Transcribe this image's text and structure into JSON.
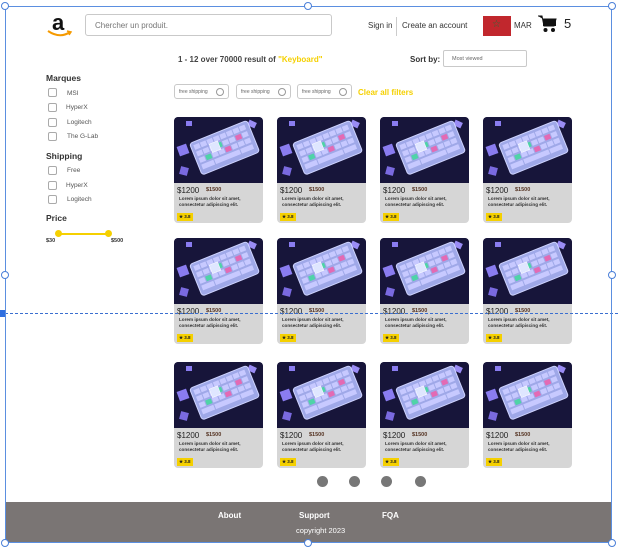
{
  "header": {
    "logo_letter": "a",
    "search_placeholder": "Chercher un produit.",
    "signin_label": "Sign in",
    "create_label": "Create an account",
    "country": "MAR",
    "cart_count": "5",
    "colors": {
      "flag_red": "#c1272d",
      "flag_green": "#1f6e3a"
    }
  },
  "results": {
    "text": "1 - 12 over 70000 result of",
    "keyword": "\"Keyboard\"",
    "sort_label": "Sort by:",
    "sort_value": "Most viewed"
  },
  "sidebar": {
    "brands_title": "Marques",
    "brands": [
      "MSI",
      "HyperX",
      "Logitech",
      "The G-Lab"
    ],
    "shipping_title": "Shipping",
    "shipping": [
      "Free",
      "HyperX",
      "Logitech"
    ],
    "price_title": "Price",
    "price_min": "$30",
    "price_max": "$500"
  },
  "filters": {
    "chips": [
      "free shipping",
      "free shipping",
      "free shipping"
    ],
    "clear_label": "Clear all filters",
    "accent": "#f5d000"
  },
  "products": [
    {
      "price": "$1200",
      "old_price": "$1500",
      "desc": "Lorem ipsum dolor sit amet, consectetur adipiscing elit.",
      "rating": "★ 3.8"
    },
    {
      "price": "$1200",
      "old_price": "$1500",
      "desc": "Lorem ipsum dolor sit amet, consectetur adipiscing elit.",
      "rating": "★ 3.8"
    },
    {
      "price": "$1200",
      "old_price": "$1500",
      "desc": "Lorem ipsum dolor sit amet, consectetur adipiscing elit.",
      "rating": "★ 3.8"
    },
    {
      "price": "$1200",
      "old_price": "$1500",
      "desc": "Lorem ipsum dolor sit amet, consectetur adipiscing elit.",
      "rating": "★ 3.8"
    },
    {
      "price": "$1200",
      "old_price": "$1500",
      "desc": "Lorem ipsum dolor sit amet, consectetur adipiscing elit.",
      "rating": "★ 3.8"
    },
    {
      "price": "$1200",
      "old_price": "$1500",
      "desc": "Lorem ipsum dolor sit amet, consectetur adipiscing elit.",
      "rating": "★ 3.8"
    },
    {
      "price": "$1200",
      "old_price": "$1500",
      "desc": "Lorem ipsum dolor sit amet, consectetur adipiscing elit.",
      "rating": "★ 3.8"
    },
    {
      "price": "$1200",
      "old_price": "$1500",
      "desc": "Lorem ipsum dolor sit amet, consectetur adipiscing elit.",
      "rating": "★ 3.8"
    },
    {
      "price": "$1200",
      "old_price": "$1500",
      "desc": "Lorem ipsum dolor sit amet, consectetur adipiscing elit.",
      "rating": "★ 3.8"
    },
    {
      "price": "$1200",
      "old_price": "$1500",
      "desc": "Lorem ipsum dolor sit amet, consectetur adipiscing elit.",
      "rating": "★ 3.8"
    },
    {
      "price": "$1200",
      "old_price": "$1500",
      "desc": "Lorem ipsum dolor sit amet, consectetur adipiscing elit.",
      "rating": "★ 3.8"
    },
    {
      "price": "$1200",
      "old_price": "$1500",
      "desc": "Lorem ipsum dolor sit amet, consectetur adipiscing elit.",
      "rating": "★ 3.8"
    }
  ],
  "pagination": {
    "pages": 4
  },
  "footer": {
    "links": [
      "About",
      "Support",
      "FQA"
    ],
    "copyright": "copyright 2023",
    "bg": "#7a7574"
  }
}
